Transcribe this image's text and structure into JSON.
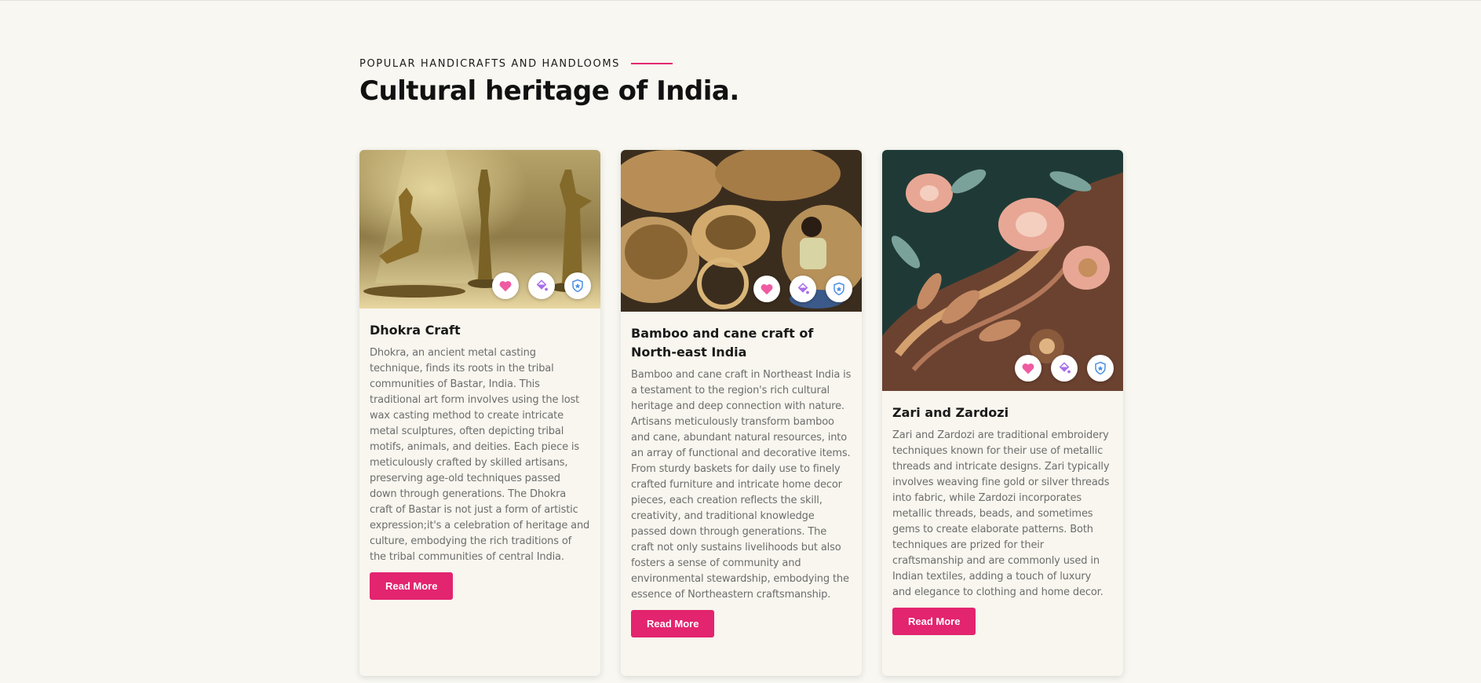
{
  "section": {
    "eyebrow": "POPULAR HANDICRAFTS AND HANDLOOMS",
    "title": "Cultural heritage of India."
  },
  "colors": {
    "accent": "#e3246f",
    "background": "#f8f7f1",
    "heart_icon": "#ef5ba1",
    "paint_icon": "#a86ee8",
    "shield_icon": "#4a90e2"
  },
  "action_icons": [
    "heart-icon",
    "paint-bucket-icon",
    "shield-icon"
  ],
  "cards": [
    {
      "title": "Dhokra Craft",
      "text": "Dhokra, an ancient metal casting technique, finds its roots in the tribal communities of Bastar, India. This traditional art form involves using the lost wax casting method to create intricate metal sculptures, often depicting tribal motifs, animals, and deities. Each piece is meticulously crafted by skilled artisans, preserving age-old techniques passed down through generations. The Dhokra craft of Bastar is not just a form of artistic expression;it's a celebration of heritage and culture, embodying the rich traditions of the tribal communities of central India.",
      "button": "Read More"
    },
    {
      "title": "Bamboo and cane craft of North-east India",
      "text": "Bamboo and cane craft in Northeast India is a testament to the region's rich cultural heritage and deep connection with nature. Artisans meticulously transform bamboo and cane, abundant natural resources, into an array of functional and decorative items. From sturdy baskets for daily use to finely crafted furniture and intricate home decor pieces, each creation reflects the skill, creativity, and traditional knowledge passed down through generations. The craft not only sustains livelihoods but also fosters a sense of community and environmental stewardship, embodying the essence of Northeastern craftsmanship.",
      "button": "Read More"
    },
    {
      "title": "Zari and Zardozi",
      "text": "Zari and Zardozi are traditional embroidery techniques known for their use of metallic threads and intricate designs. Zari typically involves weaving fine gold or silver threads into fabric, while Zardozi incorporates metallic threads, beads, and sometimes gems to create elaborate patterns. Both techniques are prized for their craftsmanship and are commonly used in Indian textiles, adding a touch of luxury and elegance to clothing and home decor.",
      "button": "Read More"
    }
  ]
}
